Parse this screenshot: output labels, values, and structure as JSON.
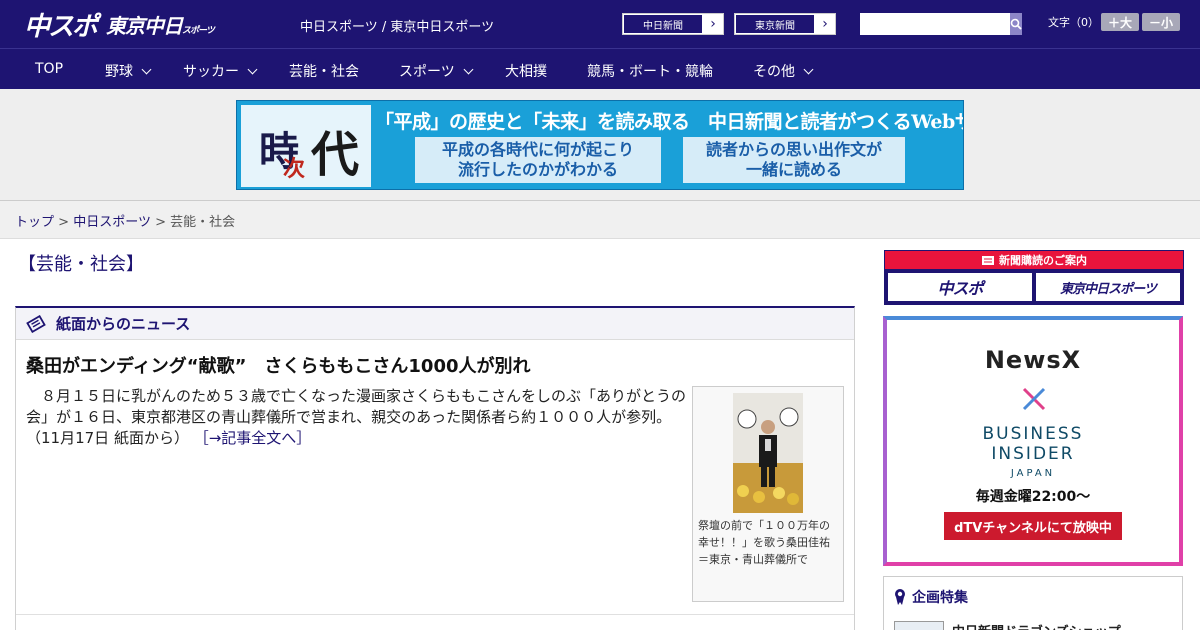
{
  "header": {
    "logo_main": "中スポ",
    "logo_sub": "東京中日",
    "logo_sub_small": "スポーツ",
    "site_title": "中日スポーツ / 東京中日スポーツ",
    "paper_buttons": [
      {
        "label": "中日新聞"
      },
      {
        "label": "東京新聞"
      }
    ],
    "search_placeholder": "",
    "fontsize_label": "文字（0）",
    "font_increase": "＋大",
    "font_decrease": "－小"
  },
  "nav": {
    "items": [
      {
        "label": "TOP",
        "dropdown": false
      },
      {
        "label": "野球",
        "dropdown": true
      },
      {
        "label": "サッカー",
        "dropdown": true
      },
      {
        "label": "芸能・社会",
        "dropdown": false
      },
      {
        "label": "スポーツ",
        "dropdown": true
      },
      {
        "label": "大相撲",
        "dropdown": false
      },
      {
        "label": "競馬・ボート・競輪",
        "dropdown": false
      },
      {
        "label": "その他",
        "dropdown": true
      }
    ]
  },
  "banner": {
    "kanji_1": "時",
    "kanji_2": "次",
    "kanji_3": "代",
    "headline": "「平成」の歴史と「未来」を読み取る　中日新聞と読者がつくるWebサイト",
    "box_left_1": "平成の各時代に何が起こり",
    "box_left_2": "流行したのかがわかる",
    "box_right_1": "読者からの思い出作文が",
    "box_right_2": "一緒に読める"
  },
  "breadcrumb": {
    "home": "トップ",
    "sep": ">",
    "section": "中日スポーツ",
    "current": "芸能・社会"
  },
  "category_title": "【芸能・社会】",
  "newsbox": {
    "heading": "紙面からのニュース",
    "article": {
      "title": "桑田がエンディング“献歌”　さくらももこさん1000人が別れ",
      "body": "８月１５日に乳がんのため５３歳で亡くなった漫画家さくらももこさんをしのぶ「ありがとうの会」が１６日、東京都港区の青山葬儀所で営まれ、親交のあった関係者ら約１０００人が参列。（11月17日 紙面から）",
      "more_link": "［→記事全文へ］",
      "photo_caption": "祭壇の前で「１００万年の幸せ！！」を歌う桑田佳祐＝東京・青山葬儀所で"
    }
  },
  "sidebar": {
    "subscription": {
      "heading": "新聞購読のご案内",
      "buttons": [
        {
          "label": "中スポ"
        },
        {
          "label": "東京中日スポーツ"
        }
      ]
    },
    "ad": {
      "newsx": "NewsX",
      "bi_1": "BUSINESS",
      "bi_2": "INSIDER",
      "bi_jp": "JAPAN",
      "schedule": "毎週金曜22:00〜",
      "cta": "dTVチャンネルにて放映中"
    },
    "feature": {
      "heading": "企画特集",
      "item": "中日新聞ドラゴンズショップ"
    }
  },
  "colors": {
    "brand": "#1e1472",
    "accent_red": "#e8143c",
    "banner_blue": "#1aa0d8"
  }
}
